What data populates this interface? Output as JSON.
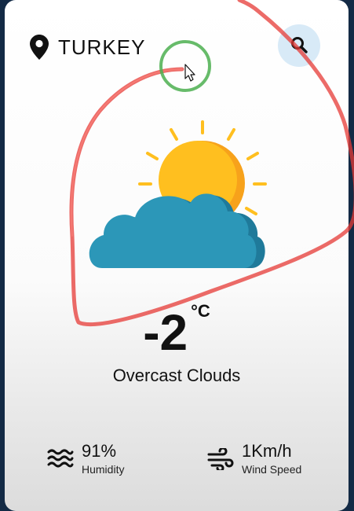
{
  "location": {
    "value": "TURKEY",
    "icon": "map-pin-icon"
  },
  "search": {
    "icon": "search-icon"
  },
  "weather": {
    "icon": "partly-cloudy-icon",
    "temperature": "-2",
    "unit": "°C",
    "condition": "Overcast Clouds"
  },
  "details": {
    "humidity": {
      "value": "91%",
      "label": "Humidity",
      "icon": "waves-icon"
    },
    "wind": {
      "value": "1Km/h",
      "label": "Wind Speed",
      "icon": "wind-icon"
    }
  },
  "colors": {
    "sun": "#ffbf1f",
    "sun_shadow": "#f7a21b",
    "cloud": "#2c97b8",
    "cloud_shadow": "#1f7a9a",
    "search_bg": "#d8eaf7",
    "annotation_stroke": "#e53935",
    "cursor_highlight": "#4caf50"
  }
}
